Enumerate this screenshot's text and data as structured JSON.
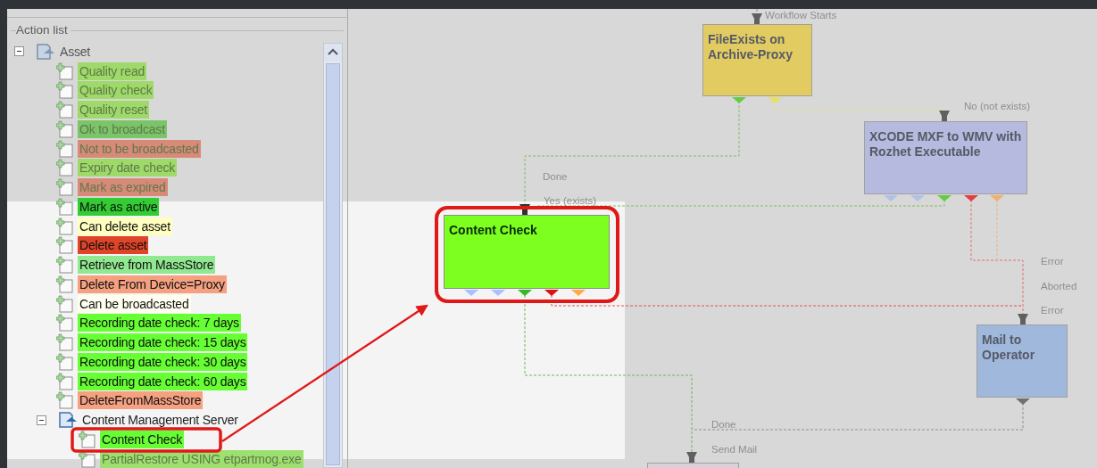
{
  "action_list": {
    "title": "Action list",
    "tree": [
      {
        "kind": "group",
        "label": "Asset",
        "expanded": true,
        "dimmed": true,
        "children": [
          {
            "kind": "action",
            "label": "Quality read",
            "color": "#9ed96a",
            "dimmed": true
          },
          {
            "kind": "action",
            "label": "Quality check",
            "color": "#9ed96a",
            "dimmed": true
          },
          {
            "kind": "action",
            "label": "Quality reset",
            "color": "#9ed96a",
            "dimmed": true
          },
          {
            "kind": "action",
            "label": "Ok to broadcast",
            "color": "#7cc46a",
            "dimmed": true
          },
          {
            "kind": "action",
            "label": "Not to be broadcasted",
            "color": "#d88a78",
            "dimmed": true
          },
          {
            "kind": "action",
            "label": "Expiry date check",
            "color": "#9ed96a",
            "dimmed": true
          },
          {
            "kind": "action",
            "label": "Mark as expired",
            "color": "#d88a78",
            "dimmed": true
          },
          {
            "kind": "action",
            "label": "Mark as active",
            "color": "#33cc33",
            "dimmed": false
          },
          {
            "kind": "action",
            "label": "Can delete asset",
            "color": "#ffffc0",
            "dimmed": false
          },
          {
            "kind": "action",
            "label": "Delete asset",
            "color": "#e04428",
            "dimmed": false
          },
          {
            "kind": "action",
            "label": "Retrieve from MassStore",
            "color": "#90e890",
            "dimmed": false
          },
          {
            "kind": "action",
            "label": "Delete From Device=Proxy",
            "color": "#f5a080",
            "dimmed": false
          },
          {
            "kind": "action",
            "label": "Can be broadcasted",
            "color": "#fffff0",
            "dimmed": false
          },
          {
            "kind": "action",
            "label": "Recording date check: 7 days",
            "color": "#66ff33",
            "dimmed": false
          },
          {
            "kind": "action",
            "label": "Recording date check: 15 days",
            "color": "#66ff33",
            "dimmed": false
          },
          {
            "kind": "action",
            "label": "Recording date check: 30 days",
            "color": "#66ff33",
            "dimmed": false
          },
          {
            "kind": "action",
            "label": "Recording date check: 60 days",
            "color": "#66ff33",
            "dimmed": false
          },
          {
            "kind": "action",
            "label": "DeleteFromMassStore",
            "color": "#f5a080",
            "dimmed": false
          },
          {
            "kind": "group",
            "label": "Content Management Server",
            "expanded": true,
            "dimmed": false,
            "children": [
              {
                "kind": "action",
                "label": "Content Check",
                "color": "#66ff33",
                "dimmed": false
              },
              {
                "kind": "action",
                "label": "PartialRestore USING etpartmog.exe",
                "color": "#9ee070",
                "dimmed": true
              }
            ]
          }
        ]
      }
    ]
  },
  "workflow": {
    "nodes": [
      {
        "title": "FileExists on Archive-Proxy",
        "color": "#e2cc62",
        "dimmed": true,
        "ports": [
          {
            "color": "#66cc44"
          },
          {
            "color": "#e8e060"
          }
        ]
      },
      {
        "title": "XCODE MXF to WMV with Rozhet Executable",
        "color": "#b6bade",
        "dimmed": true,
        "ports": [
          {
            "color": "#b0c0e8"
          },
          {
            "color": "#b0c0e8"
          },
          {
            "color": "#66cc44"
          },
          {
            "color": "#e04040"
          },
          {
            "color": "#f0b070"
          }
        ]
      },
      {
        "title": "Content Check",
        "color": "#7dff20",
        "dimmed": false,
        "ports": [
          {
            "color": "#a8c0ff"
          },
          {
            "color": "#a8c0ff"
          },
          {
            "color": "#33bb22"
          },
          {
            "color": "#dd1111"
          },
          {
            "color": "#ffaa44"
          }
        ]
      },
      {
        "title": "Mail to Operator",
        "color": "#a0b8dc",
        "dimmed": true,
        "ports": [
          {
            "color": "#707070"
          }
        ]
      },
      {
        "color": "#dcd0d8",
        "dimmed": true
      }
    ],
    "edge_labels": [
      "Workflow Starts",
      "Done",
      "Yes (exists)",
      "No (not exists)",
      "Error",
      "Aborted",
      "Error",
      "Done",
      "Send Mail"
    ]
  }
}
